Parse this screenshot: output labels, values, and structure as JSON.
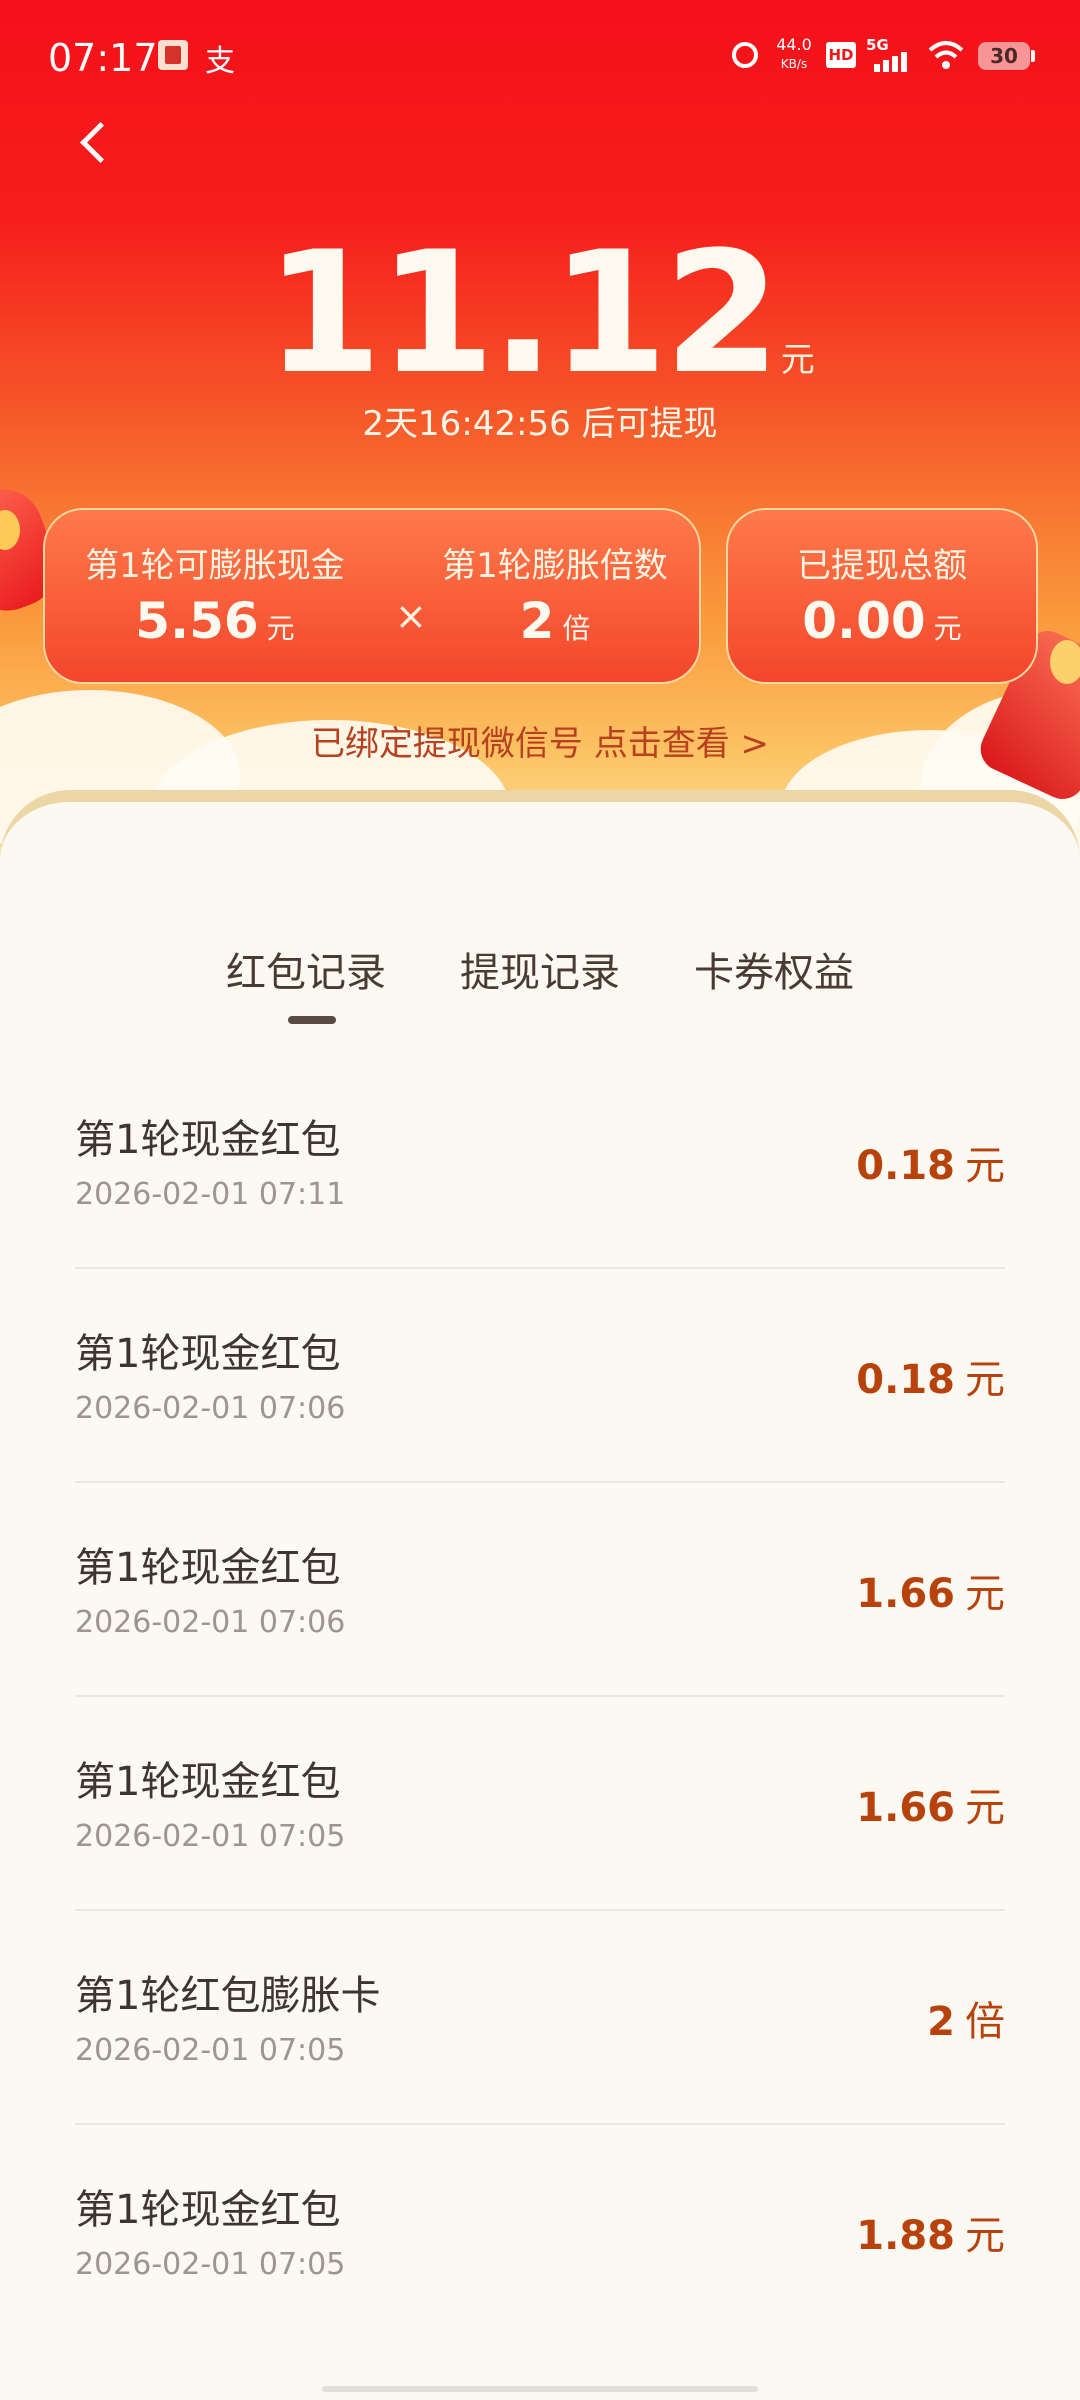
{
  "status_bar": {
    "time": "07:17",
    "app_icon_2": "支",
    "net_speed": "44.0",
    "net_speed_unit": "KB/s",
    "hd_label": "HD",
    "signal_label": "5G",
    "battery": "30"
  },
  "header": {
    "amount": "11.12",
    "amount_unit": "元",
    "countdown": "2天16:42:56 后可提现"
  },
  "cards": {
    "expand_cash_label": "第1轮可膨胀现金",
    "expand_cash_value": "5.56",
    "expand_cash_unit": "元",
    "times_symbol": "×",
    "multiplier_label": "第1轮膨胀倍数",
    "multiplier_value": "2",
    "multiplier_unit": "倍",
    "withdrawn_label": "已提现总额",
    "withdrawn_value": "0.00",
    "withdrawn_unit": "元"
  },
  "wechat_link": "已绑定提现微信号 点击查看 >",
  "tabs": [
    {
      "label": "红包记录"
    },
    {
      "label": "提现记录"
    },
    {
      "label": "卡券权益"
    }
  ],
  "records": [
    {
      "title": "第1轮现金红包",
      "date": "2026-02-01 07:11",
      "value": "0.18",
      "unit": "元"
    },
    {
      "title": "第1轮现金红包",
      "date": "2026-02-01 07:06",
      "value": "0.18",
      "unit": "元"
    },
    {
      "title": "第1轮现金红包",
      "date": "2026-02-01 07:06",
      "value": "1.66",
      "unit": "元"
    },
    {
      "title": "第1轮现金红包",
      "date": "2026-02-01 07:05",
      "value": "1.66",
      "unit": "元"
    },
    {
      "title": "第1轮红包膨胀卡",
      "date": "2026-02-01 07:05",
      "value": "2",
      "unit": "倍"
    },
    {
      "title": "第1轮现金红包",
      "date": "2026-02-01 07:05",
      "value": "1.88",
      "unit": "元"
    }
  ],
  "colors": {
    "header_red": "#f5101a",
    "header_gold": "#fde3a4",
    "accent_value": "#b8420c",
    "page_bg": "#fcf8f2"
  }
}
